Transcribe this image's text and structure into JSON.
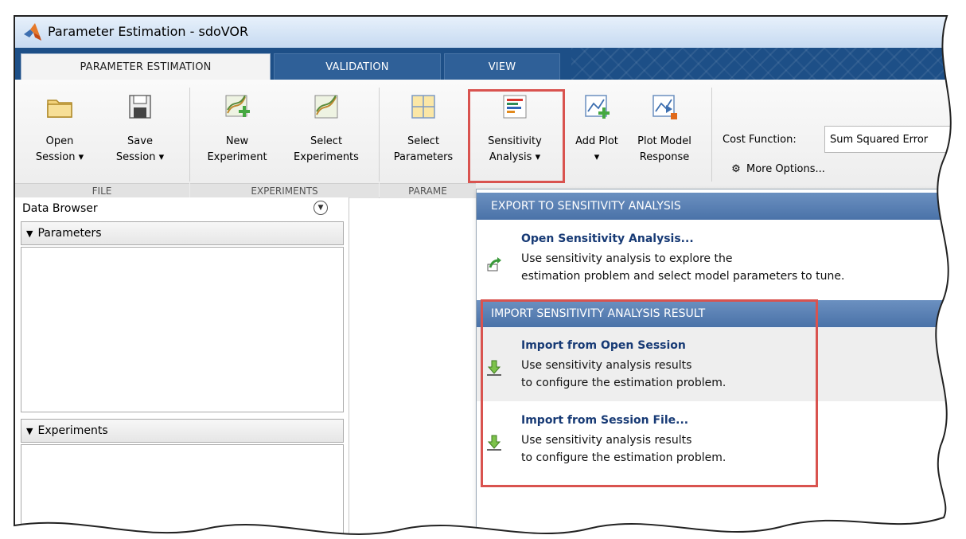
{
  "window": {
    "title": "Parameter Estimation - sdoVOR"
  },
  "tabs": [
    {
      "label": "PARAMETER ESTIMATION"
    },
    {
      "label": "VALIDATION"
    },
    {
      "label": "VIEW"
    }
  ],
  "toolstrip": {
    "file": {
      "group_label": "FILE",
      "open_session": "Open\nSession ▾",
      "save_session": "Save\nSession ▾"
    },
    "experiments": {
      "group_label": "EXPERIMENTS",
      "new_experiment": "New\nExperiment",
      "select_experiments": "Select\nExperiments"
    },
    "parameters": {
      "group_label": "PARAME",
      "select_parameters": "Select\nParameters"
    },
    "sensitivity_analysis": "Sensitivity\nAnalysis ▾",
    "add_plot": "Add Plot\n▾",
    "plot_model_response": "Plot Model\nResponse",
    "cost_function_label": "Cost Function:",
    "cost_function_value": "Sum Squared Error",
    "more_options": "More Options..."
  },
  "data_browser": {
    "title": "Data Browser",
    "parameters_label": "Parameters",
    "experiments_label": "Experiments"
  },
  "menu": {
    "export_header": "EXPORT TO SENSITIVITY ANALYSIS",
    "open_sa": {
      "title": "Open Sensitivity Analysis...",
      "desc1": "Use sensitivity analysis to explore the",
      "desc2": "estimation problem and select model parameters to tune."
    },
    "import_header": "IMPORT SENSITIVITY ANALYSIS RESULT",
    "import_open": {
      "title": "Import from Open Session",
      "desc1": "Use sensitivity analysis results",
      "desc2": "to configure the estimation problem."
    },
    "import_file": {
      "title": "Import from Session File...",
      "desc1": "Use sensitivity analysis results",
      "desc2": "to configure the estimation problem."
    }
  },
  "colors": {
    "tab_strip": "#1d4f87",
    "highlight": "#d9534f",
    "menu_header": "#5a80b4"
  }
}
